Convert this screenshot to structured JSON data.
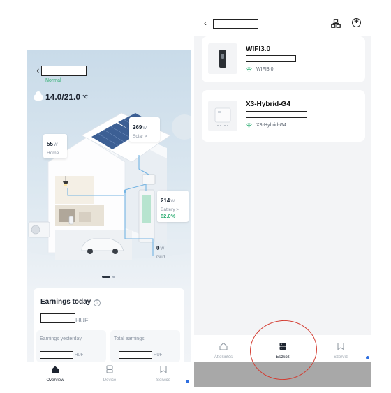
{
  "left_app": {
    "status": "Normal",
    "weather": {
      "icon": "cloud-icon",
      "temp": "14.0/21.0",
      "unit": "℃"
    },
    "flows": {
      "solar": {
        "value": "269",
        "unit": "W",
        "label": "Solar >"
      },
      "home": {
        "value": "55",
        "unit": "W",
        "label": "Home"
      },
      "battery": {
        "value": "214",
        "unit": "W",
        "label": "Battery >",
        "soc": "82.0%",
        "soc_fraction": 0.82
      },
      "grid": {
        "value": "0",
        "unit": "W",
        "label": "Grid"
      }
    },
    "earnings": {
      "title": "Earnings today",
      "today_unit": "HUF",
      "yesterday_label": "Earnings yesterday",
      "yesterday_unit": "HUF",
      "total_label": "Total earnings",
      "total_unit": "HUF"
    },
    "nav": [
      {
        "label": "Overview",
        "icon": "home-icon",
        "active": true
      },
      {
        "label": "Device",
        "icon": "device-icon",
        "active": false
      },
      {
        "label": "Service",
        "icon": "service-icon",
        "active": false
      }
    ]
  },
  "right_app": {
    "devices": [
      {
        "name": "WIFI3.0",
        "wifi": "WIFI3.0",
        "icon": "dongle-icon"
      },
      {
        "name": "X3-Hybrid-G4",
        "wifi": "X3-Hybrid-G4",
        "icon": "inverter-icon"
      }
    ],
    "nav": [
      {
        "label": "Áttekintés",
        "icon": "home-icon",
        "active": false
      },
      {
        "label": "Eszköz",
        "icon": "device-icon",
        "active": true
      },
      {
        "label": "Szervíz",
        "icon": "service-icon",
        "active": false
      }
    ]
  },
  "colors": {
    "accent_green": "#2fae74",
    "active_nav": "#1d2430",
    "annotation": "#d33a2f",
    "badge_blue": "#2f6fe0"
  }
}
